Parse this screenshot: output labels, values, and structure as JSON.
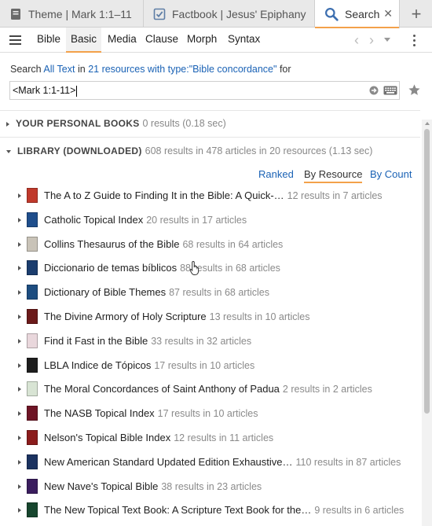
{
  "tabs": [
    {
      "label": "Theme | Mark 1:1–11",
      "icon": "theme-guide-icon"
    },
    {
      "label": "Factbook | Jesus' Epiphany",
      "icon": "factbook-icon"
    },
    {
      "label": "Search",
      "icon": "search-icon",
      "close": "✕"
    }
  ],
  "tab_add": "+",
  "toolbar": {
    "tabs": [
      "Bible",
      "Basic",
      "Media",
      "Clause",
      "Morph",
      "Syntax"
    ],
    "active_tab": "Basic",
    "back": "‹",
    "forward": "›"
  },
  "search": {
    "prefix": "Search",
    "scope": "All Text",
    "in": "in",
    "resources": "21 resources with type:\"Bible concordance\"",
    "for": "for",
    "query": "<Mark 1:1-11>"
  },
  "sections": {
    "personal": {
      "title": "YOUR PERSONAL BOOKS",
      "meta": "0 results (0.18 sec)"
    },
    "library": {
      "title": "LIBRARY (DOWNLOADED)",
      "meta": "608 results in 478 articles in 20 resources (1.13 sec)"
    }
  },
  "sort": {
    "ranked": "Ranked",
    "by_resource": "By Resource",
    "by_count": "By Count"
  },
  "resources": [
    {
      "title": "The A to Z Guide to Finding It in the Bible: A Quick-…",
      "meta": "12 results in 7 articles",
      "color": "#c0392b"
    },
    {
      "title": "Catholic Topical Index",
      "meta": "20 results in 17 articles",
      "color": "#1f4e8c"
    },
    {
      "title": "Collins Thesaurus of the Bible",
      "meta": "68 results in 64 articles",
      "color": "#c9c3b8"
    },
    {
      "title": "Diccionario de temas bíblicos",
      "meta": "88 results in 68 articles",
      "color": "#1b3d6e"
    },
    {
      "title": "Dictionary of Bible Themes",
      "meta": "87 results in 68 articles",
      "color": "#1d4d80"
    },
    {
      "title": "The Divine Armory of Holy Scripture",
      "meta": "13 results in 10 articles",
      "color": "#6b1a1a"
    },
    {
      "title": "Find it Fast in the Bible",
      "meta": "33 results in 32 articles",
      "color": "#e9d7dc"
    },
    {
      "title": "LBLA Indice de Tópicos",
      "meta": "17 results in 10 articles",
      "color": "#1e1e1e"
    },
    {
      "title": "The Moral Concordances of Saint Anthony of Padua",
      "meta": "2 results in 2 articles",
      "color": "#d8e4d4"
    },
    {
      "title": "The NASB Topical Index",
      "meta": "17 results in 10 articles",
      "color": "#6e1425"
    },
    {
      "title": "Nelson's Topical Bible Index",
      "meta": "12 results in 11 articles",
      "color": "#8b1c1c"
    },
    {
      "title": "New American Standard Updated Edition Exhaustive…",
      "meta": "110 results in 87 articles",
      "color": "#1b3260"
    },
    {
      "title": "New Nave's Topical Bible",
      "meta": "38 results in 23 articles",
      "color": "#3a1d5e"
    },
    {
      "title": "The New Topical Text Book: A Scripture Text Book for the…",
      "meta": "9 results in 6 articles",
      "color": "#17462e"
    }
  ]
}
